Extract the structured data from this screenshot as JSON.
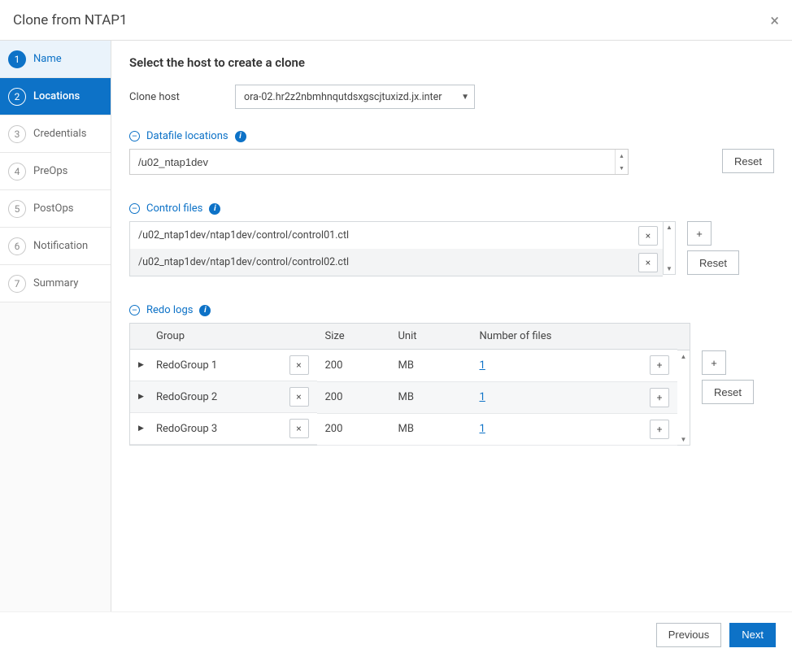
{
  "header": {
    "title": "Clone from NTAP1"
  },
  "steps": [
    {
      "num": "1",
      "label": "Name",
      "state": "completed"
    },
    {
      "num": "2",
      "label": "Locations",
      "state": "current"
    },
    {
      "num": "3",
      "label": "Credentials",
      "state": "pending"
    },
    {
      "num": "4",
      "label": "PreOps",
      "state": "pending"
    },
    {
      "num": "5",
      "label": "PostOps",
      "state": "pending"
    },
    {
      "num": "6",
      "label": "Notification",
      "state": "pending"
    },
    {
      "num": "7",
      "label": "Summary",
      "state": "pending"
    }
  ],
  "page": {
    "title": "Select the host to create a clone",
    "clone_host_label": "Clone host",
    "clone_host_value": "ora-02.hr2z2nbmhnqutdsxgscjtuxizd.jx.inter"
  },
  "sections": {
    "datafile": {
      "title": "Datafile locations",
      "value": "/u02_ntap1dev",
      "reset": "Reset"
    },
    "control": {
      "title": "Control files",
      "rows": [
        "/u02_ntap1dev/ntap1dev/control/control01.ctl",
        "/u02_ntap1dev/ntap1dev/control/control02.ctl"
      ],
      "add": "+",
      "reset": "Reset"
    },
    "redo": {
      "title": "Redo logs",
      "headers": {
        "group": "Group",
        "size": "Size",
        "unit": "Unit",
        "num": "Number of files"
      },
      "rows": [
        {
          "group": "RedoGroup 1",
          "size": "200",
          "unit": "MB",
          "num": "1"
        },
        {
          "group": "RedoGroup 2",
          "size": "200",
          "unit": "MB",
          "num": "1"
        },
        {
          "group": "RedoGroup 3",
          "size": "200",
          "unit": "MB",
          "num": "1"
        }
      ],
      "add": "+",
      "reset": "Reset"
    }
  },
  "footer": {
    "prev": "Previous",
    "next": "Next"
  }
}
